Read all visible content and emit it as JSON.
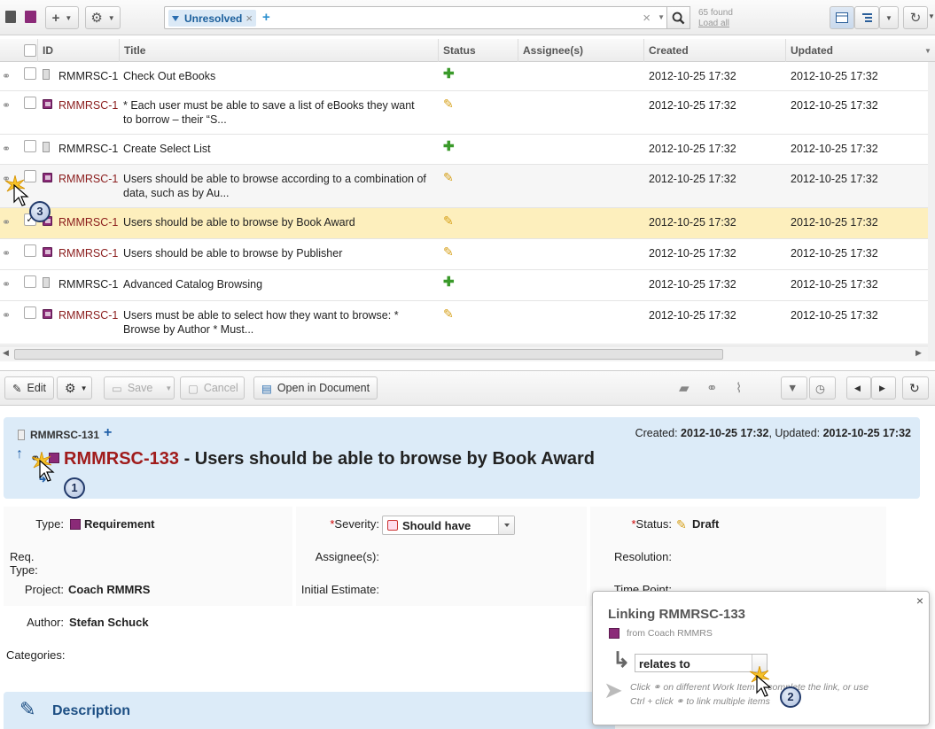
{
  "toolbar": {
    "add_label": "+",
    "gear_label": "⚙",
    "filter_chip": "Unresolved",
    "found_count": "65 found",
    "load_all": "Load all"
  },
  "columns": [
    "ID",
    "Title",
    "Status",
    "Assignee(s)",
    "Created",
    "Updated"
  ],
  "rows": [
    {
      "id": "RMMRSC-1",
      "title": "Check Out eBooks",
      "title2": "",
      "kind": "doc",
      "status": "green",
      "created": "2012-10-25 17:32",
      "updated": "2012-10-25 17:32"
    },
    {
      "id": "RMMRSC-1",
      "title": "* Each user must be able to save a list of eBooks they want",
      "title2": "to borrow – their “S...",
      "kind": "req",
      "status": "draft",
      "created": "2012-10-25 17:32",
      "updated": "2012-10-25 17:32"
    },
    {
      "id": "RMMRSC-1",
      "title": "Create Select List",
      "title2": "",
      "kind": "doc",
      "status": "green",
      "created": "2012-10-25 17:32",
      "updated": "2012-10-25 17:32"
    },
    {
      "id": "RMMRSC-1",
      "title": "Users should be able to browse according to a combination of",
      "title2": "data, such as by Au...",
      "kind": "req",
      "status": "draft",
      "created": "2012-10-25 17:32",
      "updated": "2012-10-25 17:32"
    },
    {
      "id": "RMMRSC-1",
      "title": "Users should be able to browse by Book Award",
      "title2": "",
      "kind": "req",
      "status": "draft",
      "created": "2012-10-25 17:32",
      "updated": "2012-10-25 17:32"
    },
    {
      "id": "RMMRSC-1",
      "title": "Users should be able to browse by Publisher",
      "title2": "",
      "kind": "req",
      "status": "draft",
      "created": "2012-10-25 17:32",
      "updated": "2012-10-25 17:32"
    },
    {
      "id": "RMMRSC-1",
      "title": "Advanced Catalog Browsing",
      "title2": "",
      "kind": "doc",
      "status": "green",
      "created": "2012-10-25 17:32",
      "updated": "2012-10-25 17:32"
    },
    {
      "id": "RMMRSC-1",
      "title": "Users must be able to select how they want to browse: *",
      "title2": "Browse by Author * Must...",
      "kind": "req",
      "status": "draft",
      "created": "2012-10-25 17:32",
      "updated": "2012-10-25 17:32"
    }
  ],
  "detail_toolbar": {
    "edit": "Edit",
    "save": "Save",
    "cancel": "Cancel",
    "open_in_document": "Open in Document"
  },
  "detail": {
    "parent_id": "RMMRSC-131",
    "created_label": "Created:",
    "created_value": "2012-10-25 17:32",
    "updated_label": ", Updated:",
    "updated_value": "2012-10-25 17:32",
    "item_id": "RMMRSC-133",
    "item_title": " - Users should be able to browse by Book Award"
  },
  "fields": {
    "type_label": "Type:",
    "type_value": "Requirement",
    "req_type_label": "Req. Type:",
    "project_label": "Project:",
    "project_value": "Coach RMMRS",
    "author_label": "Author:",
    "author_value": "Stefan Schuck",
    "categories_label": "Categories:",
    "severity_label": "Severity:",
    "severity_value": "Should have",
    "assignees_label": "Assignee(s):",
    "estimate_label": "Initial Estimate:",
    "status_label": "Status:",
    "status_value": "Draft",
    "resolution_label": "Resolution:",
    "time_point_label": "Time Point:"
  },
  "description_label": "Description",
  "popup": {
    "title": "Linking RMMRSC-133",
    "from": "from Coach RMMRS",
    "role": "relates to",
    "hint_line1": "Click ⚭ on different Work Item to complete the link, or use",
    "hint_line2": "Ctrl + click ⚭ to link multiple items"
  },
  "callouts": [
    "1",
    "2",
    "3"
  ],
  "colors": {
    "id_red": "#8a1c1c",
    "selected_row": "#fdefbd",
    "header_blue": "#dcebf8",
    "requirement_purple": "#8b2a78"
  }
}
